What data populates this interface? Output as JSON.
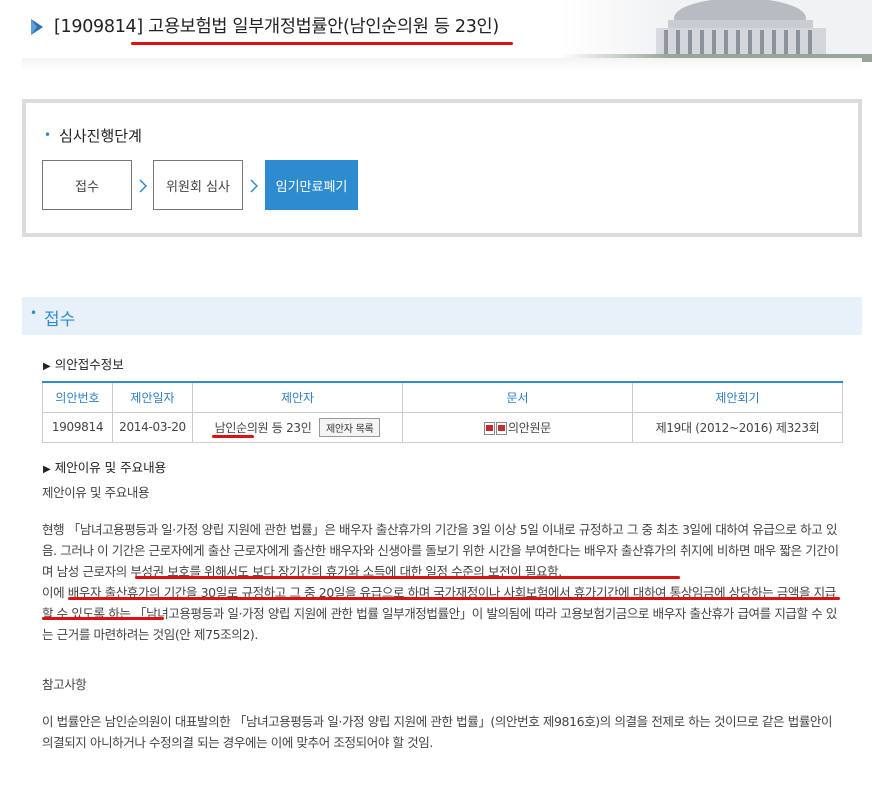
{
  "header": {
    "bill_no": "[1909814]",
    "bill_title": "고용보험법 일부개정법률안(남인순의원 등 23인)"
  },
  "stage": {
    "heading": "심사진행단계",
    "steps": [
      "접수",
      "위원회 심사",
      "임기만료폐기"
    ],
    "active_index": 2
  },
  "section": {
    "title": "접수",
    "info_heading": "의안접수정보",
    "table": {
      "headers": [
        "의안번호",
        "제안일자",
        "제안자",
        "문서",
        "제안회기"
      ],
      "row": {
        "bill_no": "1909814",
        "date": "2014-03-20",
        "proposer": "남인순의원 등 23인",
        "proposer_button": "제안자 목록",
        "document": "의안원문",
        "session": "제19대 (2012~2016) 제323회"
      }
    },
    "reason_heading": "제안이유 및 주요내용",
    "reason_label": "제안이유 및 주요내용",
    "reason_p1": "현행 「남녀고용평등과 일·가정 양립 지원에 관한 법률」은 배우자 출산휴가의 기간을 3일 이상 5일 이내로 규정하고 그 중 최초 3일에 대하여 유급으로 하고 있음. 그러나 이 기간은 근로자에게 출산 근로자에게 출산한 배우자와 신생아를 돌보기 위한 시간을 부여한다는 배우자 출산휴가의 취지에 비하면 매우 짧은 기간이며 남성 근로자의 부성권 보호를 위해서도 보다 장기간의 휴가와 소득에 대한 일정 수준의 보전이 필요함.",
    "reason_p2": "이에 배우자 출산휴가의 기간을 30일로 규정하고 그 중 20일을 유급으로 하며 국가재정이나 사회보험에서 휴가기간에 대하여 통상임금에 상당하는 금액을 지급할 수 있도록 하는 「남녀고용평등과 일·가정 양립 지원에 관한 법률 일부개정법률안」이 발의됨에 따라 고용보험기금으로 배우자 출산휴가 급여를 지급할 수 있는 근거를 마련하려는 것임(안 제75조의2).",
    "note_label": "참고사항",
    "note_text": "이 법률안은 남인순의원이 대표발의한 「남녀고용평등과 일·가정 양립 지원에 관한 법률」(의안번호 제9816호)의 의결을 전제로 하는 것이므로 같은 법률안이 의결되지 아니하거나 수정의결 되는 경우에는 이에 맞추어 조정되어야 할 것임."
  },
  "colors": {
    "accent": "#2d8bd0",
    "annotation": "#dd1111"
  }
}
